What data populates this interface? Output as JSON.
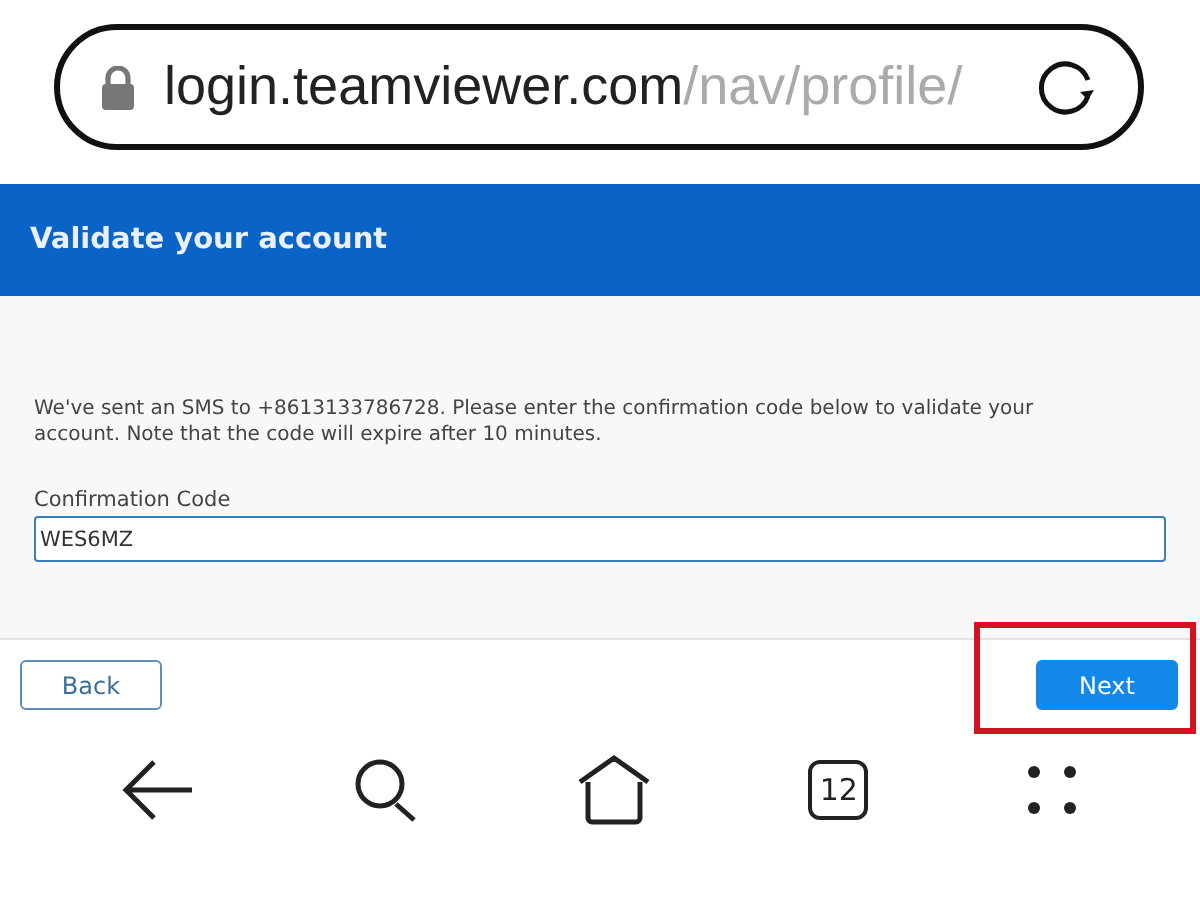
{
  "address_bar": {
    "domain": "login.teamviewer.com",
    "path": "/nav/profile/"
  },
  "header": {
    "title": "Validate your account"
  },
  "message": "We've sent an SMS to +8613133786728. Please enter the confirmation code below to validate your account. Note that the code will expire after 10 minutes.",
  "field": {
    "label": "Confirmation Code",
    "value": "WES6MZ"
  },
  "buttons": [
    {
      "label": "Back",
      "kind": "secondary",
      "highlighted": false
    },
    {
      "label": "Next",
      "kind": "primary",
      "highlighted": true
    }
  ],
  "nav_bar": {
    "tab_count": "12"
  }
}
